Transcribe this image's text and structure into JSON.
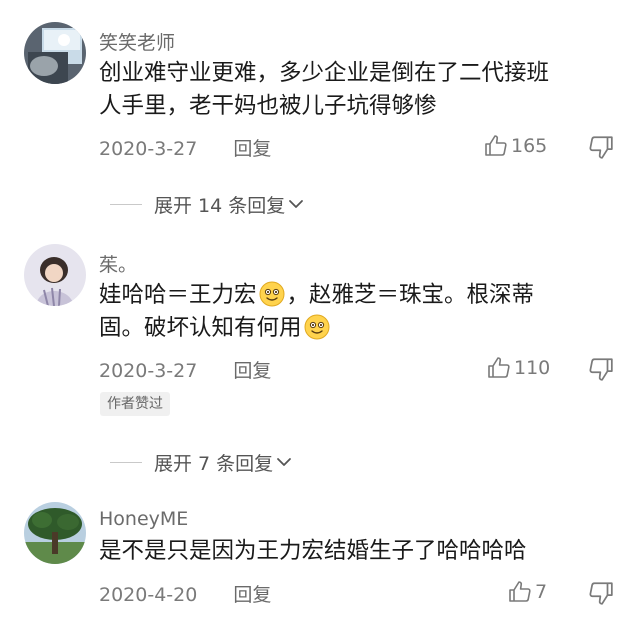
{
  "comments": [
    {
      "username": "笑笑老师",
      "text_line1": "创业难守业更难，多少企业是倒在了二代接班",
      "text_line2": "人手里，老干妈也被儿子坑得够惨",
      "date": "2020-3-27",
      "reply_label": "回复",
      "likes": "165"
    },
    {
      "username": "茱。",
      "text_part1": "娃哈哈＝王力宏",
      "text_part2": "，赵雅芝＝珠宝。根深蒂",
      "text_part3": "固。破坏认知有何用",
      "date": "2020-3-27",
      "reply_label": "回复",
      "likes": "110",
      "badge": "作者赞过"
    },
    {
      "username": "HoneyME",
      "text_line1": "是不是只是因为王力宏结婚生子了哈哈哈哈",
      "date": "2020-4-20",
      "reply_label": "回复",
      "likes": "7"
    }
  ],
  "expanders": [
    {
      "label": "展开 14 条回复"
    },
    {
      "label": "展开 7 条回复"
    }
  ],
  "colors": {
    "text": "#1a1a1a",
    "meta": "#7a7a7a",
    "badge_bg": "#f0f0f0"
  },
  "icons": {
    "like": "thumbs-up-icon",
    "dislike": "thumbs-down-icon",
    "expand": "chevron-down-icon",
    "emoji": "smiley-emoji"
  }
}
